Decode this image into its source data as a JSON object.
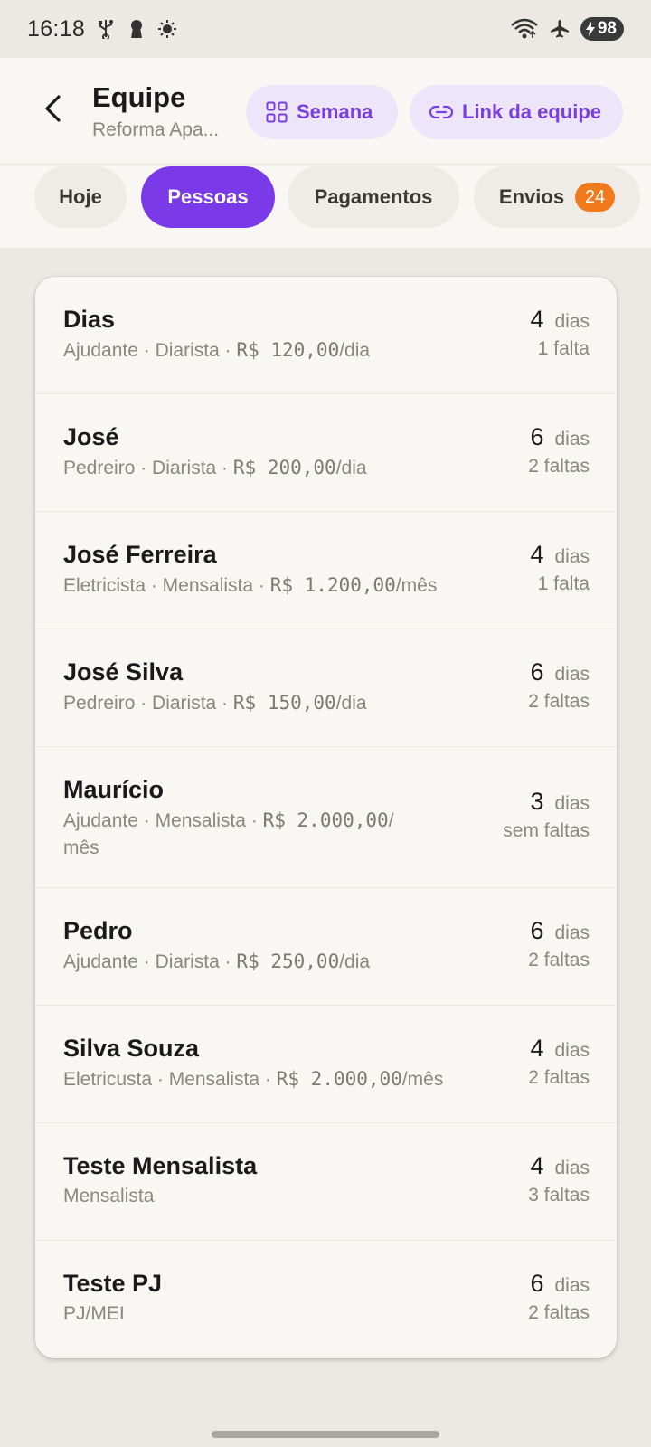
{
  "status_bar": {
    "time": "16:18",
    "battery": "98",
    "icons": [
      "usb-icon",
      "keyhole-icon",
      "brightness-icon",
      "wifi-icon",
      "airplane-icon",
      "battery-icon"
    ]
  },
  "header": {
    "title": "Equipe",
    "subtitle": "Reforma Apa...",
    "week_button": "Semana",
    "link_button": "Link da equipe",
    "accent_color": "#7a3ae8"
  },
  "tabs": {
    "items": [
      {
        "label": "Hoje"
      },
      {
        "label": "Pessoas"
      },
      {
        "label": "Pagamentos"
      },
      {
        "label": "Envios",
        "badge": "24"
      }
    ],
    "active": "Pessoas"
  },
  "people": [
    {
      "name": "Dias",
      "meta_pre": "Ajudante · Diarista · ",
      "money": "R$ 120,00",
      "meta_post": "/dia",
      "days": "4",
      "days_label": "dias",
      "absences": "1 falta"
    },
    {
      "name": "José",
      "meta_pre": "Pedreiro · Diarista · ",
      "money": "R$ 200,00",
      "meta_post": "/dia",
      "days": "6",
      "days_label": "dias",
      "absences": "2 faltas"
    },
    {
      "name": "José Ferreira",
      "meta_pre": "Eletricista · Mensalista · ",
      "money": "R$ 1.200,00",
      "meta_post": "/mês",
      "days": "4",
      "days_label": "dias",
      "absences": "1 falta"
    },
    {
      "name": "José Silva",
      "meta_pre": "Pedreiro · Diarista · ",
      "money": "R$ 150,00",
      "meta_post": "/dia",
      "days": "6",
      "days_label": "dias",
      "absences": "2 faltas"
    },
    {
      "name": "Maurício",
      "meta_pre": "Ajudante · Mensalista · ",
      "money": "R$ 2.000,00",
      "meta_post": "/",
      "meta_line2": "mês",
      "days": "3",
      "days_label": "dias",
      "absences": "sem faltas"
    },
    {
      "name": "Pedro",
      "meta_pre": "Ajudante · Diarista · ",
      "money": "R$ 250,00",
      "meta_post": "/dia",
      "days": "6",
      "days_label": "dias",
      "absences": "2 faltas"
    },
    {
      "name": "Silva Souza",
      "meta_pre": "Eletricusta · Mensalista · ",
      "money": "R$ 2.000,00",
      "meta_post": "/mês",
      "days": "4",
      "days_label": "dias",
      "absences": "2 faltas"
    },
    {
      "name": "Teste Mensalista",
      "meta_pre": "Mensalista",
      "money": "",
      "meta_post": "",
      "days": "4",
      "days_label": "dias",
      "absences": "3 faltas"
    },
    {
      "name": "Teste PJ",
      "meta_pre": "PJ/MEI",
      "money": "",
      "meta_post": "",
      "days": "6",
      "days_label": "dias",
      "absences": "2 faltas"
    }
  ]
}
